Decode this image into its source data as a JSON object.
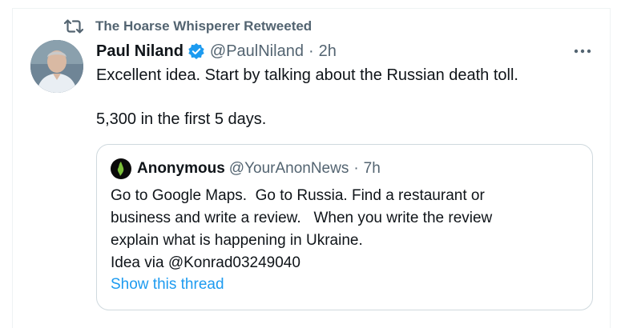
{
  "retweet": {
    "label": "The Hoarse Whisperer Retweeted",
    "icon": "retweet-icon"
  },
  "tweet": {
    "author_name": "Paul Niland",
    "verified_icon": "verified-badge-icon",
    "handle": "@PaulNiland",
    "separator": "·",
    "time": "2h",
    "more_icon": "more-options-icon",
    "lines": [
      "Excellent idea. Start by talking about the Russian death toll.",
      "5,300 in the first 5 days."
    ]
  },
  "quote": {
    "author_name": "Anonymous",
    "handle": "@YourAnonNews",
    "separator": "·",
    "time": "7h",
    "lines": [
      "Go to Google Maps.  Go to Russia. Find a restaurant or",
      "business and write a review.   When you write the review",
      "explain what is happening in Ukraine.",
      "Idea via @Konrad03249040"
    ],
    "show_thread": "Show this thread"
  },
  "colors": {
    "accent": "#1d9bf0",
    "secondary_text": "#536471",
    "primary_text": "#0f1419",
    "border": "#cfd9de"
  }
}
